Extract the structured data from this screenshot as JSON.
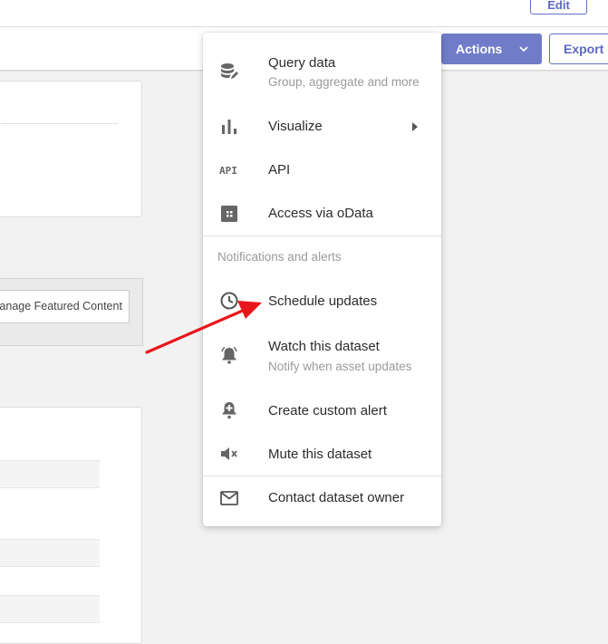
{
  "header": {
    "edit_label": "Edit"
  },
  "toolbar": {
    "actions_label": "Actions",
    "export_label": "Export"
  },
  "featured": {
    "manage_label": "Manage Featured Content"
  },
  "menu": {
    "query": {
      "label": "Query data",
      "sublabel": "Group, aggregate and more"
    },
    "visualize": {
      "label": "Visualize"
    },
    "api": {
      "label": "API",
      "icon_text": "API"
    },
    "odata": {
      "label": "Access via oData"
    },
    "notifications_header": "Notifications and alerts",
    "schedule": {
      "label": "Schedule updates"
    },
    "watch": {
      "label": "Watch this dataset",
      "sublabel": "Notify when asset updates"
    },
    "custom_alert": {
      "label": "Create custom alert"
    },
    "mute": {
      "label": "Mute this dataset"
    },
    "contact": {
      "label": "Contact dataset owner"
    }
  },
  "colors": {
    "accent": "#717cc9",
    "annotation_arrow": "#e8161b"
  }
}
